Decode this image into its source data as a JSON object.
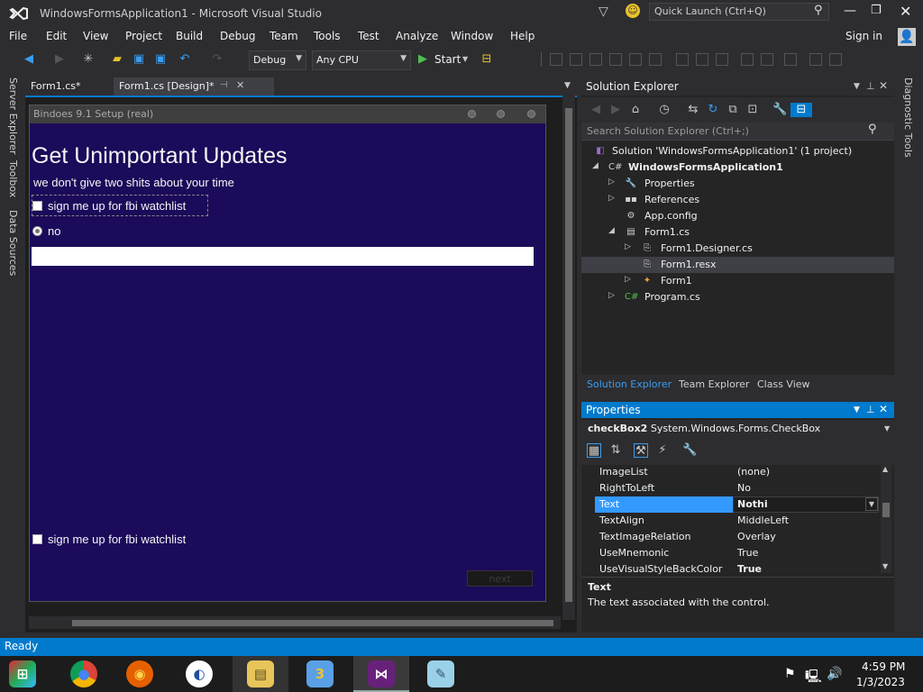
{
  "window": {
    "title": "WindowsFormsApplication1 - Microsoft Visual Studio",
    "quick_launch_placeholder": "Quick Launch (Ctrl+Q)",
    "sign_in": "Sign in"
  },
  "menu": [
    "File",
    "Edit",
    "View",
    "Project",
    "Build",
    "Debug",
    "Team",
    "Tools",
    "Test",
    "Analyze",
    "Window",
    "Help"
  ],
  "toolbar": {
    "config": "Debug",
    "platform": "Any CPU",
    "start": "Start"
  },
  "left_tabs": [
    "Server Explorer",
    "Toolbox",
    "Data Sources"
  ],
  "right_tabs": [
    "Diagnostic Tools"
  ],
  "doc_tabs": [
    {
      "label": "Form1.cs*"
    },
    {
      "label": "Form1.cs [Design]*"
    }
  ],
  "form": {
    "title": "Bindoes 9.1 Setup (real)",
    "heading": "Get Unimportant Updates",
    "subheading": "we don't give two shits about your time",
    "checkbox1": "sign me up for fbi watchlist",
    "radio1": "no",
    "checkbox2": "sign me up for fbi watchlist",
    "next_button": "next",
    "colors": {
      "background": "#1c0a5a"
    }
  },
  "solution_explorer": {
    "title": "Solution Explorer",
    "search_placeholder": "Search Solution Explorer (Ctrl+;)",
    "tree": [
      {
        "label": "Solution 'WindowsFormsApplication1' (1 project)",
        "icon": "solution-icon"
      },
      {
        "label": "WindowsFormsApplication1",
        "icon": "csharp-project-icon",
        "bold": true
      },
      {
        "label": "Properties",
        "icon": "wrench-icon"
      },
      {
        "label": "References",
        "icon": "references-icon"
      },
      {
        "label": "App.config",
        "icon": "config-icon"
      },
      {
        "label": "Form1.cs",
        "icon": "form-icon"
      },
      {
        "label": "Form1.Designer.cs",
        "icon": "cs-file-icon"
      },
      {
        "label": "Form1.resx",
        "icon": "resx-icon",
        "selected": true
      },
      {
        "label": "Form1",
        "icon": "class-icon"
      },
      {
        "label": "Program.cs",
        "icon": "csharp-file-icon"
      }
    ],
    "tabs": [
      "Solution Explorer",
      "Team Explorer",
      "Class View"
    ]
  },
  "properties": {
    "title": "Properties",
    "object": "checkBox2",
    "object_type": "System.Windows.Forms.CheckBox",
    "rows": [
      {
        "name": "ImageList",
        "value": "(none)"
      },
      {
        "name": "RightToLeft",
        "value": "No"
      },
      {
        "name": "Text",
        "value": "Nothi",
        "selected": true
      },
      {
        "name": "TextAlign",
        "value": "MiddleLeft"
      },
      {
        "name": "TextImageRelation",
        "value": "Overlay"
      },
      {
        "name": "UseMnemonic",
        "value": "True"
      },
      {
        "name": "UseVisualStyleBackColor",
        "value": "True"
      }
    ],
    "desc_title": "Text",
    "desc_text": "The text associated with the control."
  },
  "status": {
    "text": "Ready"
  },
  "taskbar": {
    "time": "4:59 PM",
    "date": "1/3/2023"
  },
  "colors": {
    "accent": "#007acc",
    "chrome": "#2d2d30",
    "panel": "#252526"
  }
}
